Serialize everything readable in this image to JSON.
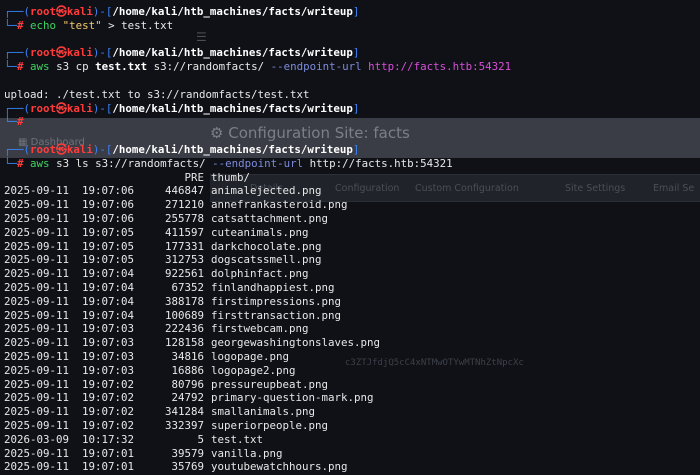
{
  "background": {
    "title": "Configuration Site: facts",
    "sidebar_label": "Dashboard",
    "tabs": [
      "Details",
      "Configuration",
      "Custom Configuration",
      "Site Settings",
      "Email Se"
    ],
    "field_text": "c3ZTJfdjQ5cC4xNTMwOTYwMTNhZtNpcXc"
  },
  "prompt": {
    "user": "root",
    "at": "㉿",
    "host": "kali",
    "path": "/home/kali/htb_machines/facts/writeup"
  },
  "commands": [
    {
      "parts": [
        {
          "t": "echo",
          "c": "cmd"
        },
        {
          "t": " ",
          "c": ""
        },
        {
          "t": "\"test\"",
          "c": "str"
        },
        {
          "t": " > test.txt",
          "c": ""
        }
      ]
    },
    {
      "parts": [
        {
          "t": "aws",
          "c": "cmd"
        },
        {
          "t": " s3 cp ",
          "c": ""
        },
        {
          "t": "test.txt",
          "c": "bold"
        },
        {
          "t": " s3://randomfacts/ ",
          "c": ""
        },
        {
          "t": "--endpoint-url",
          "c": "opt"
        },
        {
          "t": " ",
          "c": ""
        },
        {
          "t": "http://facts.htb:54321",
          "c": "url"
        }
      ]
    },
    {
      "parts": [
        {
          "t": "aws",
          "c": "cmd"
        },
        {
          "t": " s3 ls s3://randomfacts/ ",
          "c": ""
        },
        {
          "t": "--endpoint-url",
          "c": "opt"
        },
        {
          "t": " http://facts.htb:54321",
          "c": ""
        }
      ]
    }
  ],
  "upload_output": "upload: ./test.txt to s3://randomfacts/test.txt",
  "listing": {
    "pre_label": "PRE",
    "pre_name": "thumb/",
    "rows": [
      {
        "date": "2025-09-11",
        "time": "19:07:06",
        "size": "446847",
        "name": "animalejected.png"
      },
      {
        "date": "2025-09-11",
        "time": "19:07:06",
        "size": "271210",
        "name": "annefrankasteroid.png"
      },
      {
        "date": "2025-09-11",
        "time": "19:07:06",
        "size": "255778",
        "name": "catsattachment.png"
      },
      {
        "date": "2025-09-11",
        "time": "19:07:05",
        "size": "411597",
        "name": "cuteanimals.png"
      },
      {
        "date": "2025-09-11",
        "time": "19:07:05",
        "size": "177331",
        "name": "darkchocolate.png"
      },
      {
        "date": "2025-09-11",
        "time": "19:07:05",
        "size": "312753",
        "name": "dogscatssmell.png"
      },
      {
        "date": "2025-09-11",
        "time": "19:07:04",
        "size": "922561",
        "name": "dolphinfact.png"
      },
      {
        "date": "2025-09-11",
        "time": "19:07:04",
        "size": "67352",
        "name": "finlandhappiest.png"
      },
      {
        "date": "2025-09-11",
        "time": "19:07:04",
        "size": "388178",
        "name": "firstimpressions.png"
      },
      {
        "date": "2025-09-11",
        "time": "19:07:04",
        "size": "100689",
        "name": "firsttransaction.png"
      },
      {
        "date": "2025-09-11",
        "time": "19:07:03",
        "size": "222436",
        "name": "firstwebcam.png"
      },
      {
        "date": "2025-09-11",
        "time": "19:07:03",
        "size": "128158",
        "name": "georgewashingtonslaves.png"
      },
      {
        "date": "2025-09-11",
        "time": "19:07:03",
        "size": "34816",
        "name": "logopage.png"
      },
      {
        "date": "2025-09-11",
        "time": "19:07:03",
        "size": "16886",
        "name": "logopage2.png"
      },
      {
        "date": "2025-09-11",
        "time": "19:07:02",
        "size": "80796",
        "name": "pressureupbeat.png"
      },
      {
        "date": "2025-09-11",
        "time": "19:07:02",
        "size": "24792",
        "name": "primary-question-mark.png"
      },
      {
        "date": "2025-09-11",
        "time": "19:07:02",
        "size": "341284",
        "name": "smallanimals.png"
      },
      {
        "date": "2025-09-11",
        "time": "19:07:02",
        "size": "332397",
        "name": "superiorpeople.png"
      },
      {
        "date": "2026-03-09",
        "time": "10:17:32",
        "size": "5",
        "name": "test.txt"
      },
      {
        "date": "2025-09-11",
        "time": "19:07:01",
        "size": "39579",
        "name": "vanilla.png"
      },
      {
        "date": "2025-09-11",
        "time": "19:07:01",
        "size": "35769",
        "name": "youtubewatchhours.png"
      }
    ]
  }
}
